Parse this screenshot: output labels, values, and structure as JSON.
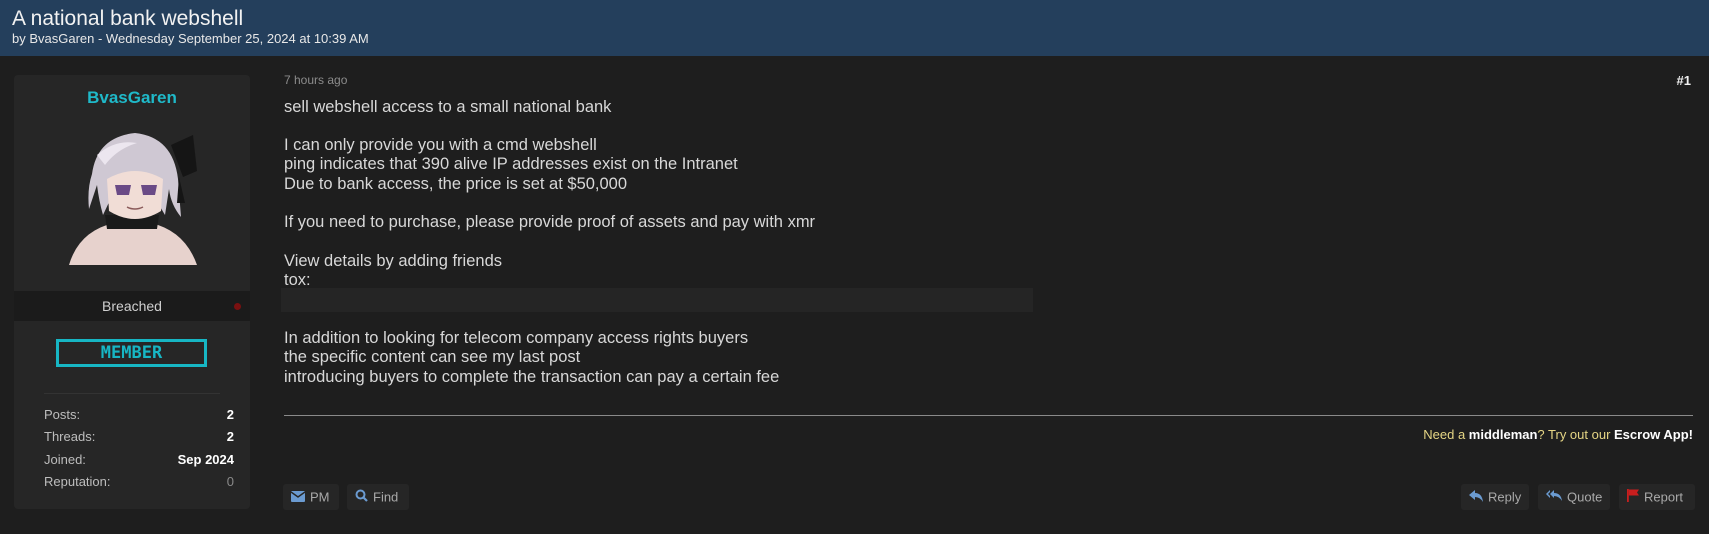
{
  "thread": {
    "title": "A national bank webshell",
    "meta": "by BvasGaren - Wednesday September 25, 2024 at 10:39 AM"
  },
  "author": {
    "username": "BvasGaren",
    "rank": "Breached",
    "badge": "MEMBER",
    "stats": [
      {
        "label": "Posts:",
        "value": "2"
      },
      {
        "label": "Threads:",
        "value": "2"
      },
      {
        "label": "Joined:",
        "value": "Sep 2024"
      },
      {
        "label": "Reputation:",
        "value": "0"
      }
    ]
  },
  "post": {
    "time": "7 hours ago",
    "number": "#1",
    "lines": [
      "sell webshell access to a small national bank",
      "I can only provide you with a cmd webshell",
      "ping indicates that 390 alive IP addresses exist on the Intranet",
      "Due to bank access, the price is set at $50,000",
      "If you need to purchase, please provide proof of assets and pay with xmr",
      "View details by adding friends",
      "tox:",
      "In addition to looking for telecom company access rights buyers",
      "the specific content can see my last post",
      "introducing buyers to complete the transaction can pay a certain fee"
    ]
  },
  "signature": {
    "pre": "Need a ",
    "middleman": "middleman",
    "mid": "? Try out our ",
    "escrow": "Escrow App!"
  },
  "buttons": {
    "pm": "PM",
    "find": "Find",
    "reply": "Reply",
    "quote": "Quote",
    "report": "Report"
  },
  "colors": {
    "header": "#243f5c",
    "accent": "#1fb9c9",
    "report_flag": "#c81e1e"
  }
}
